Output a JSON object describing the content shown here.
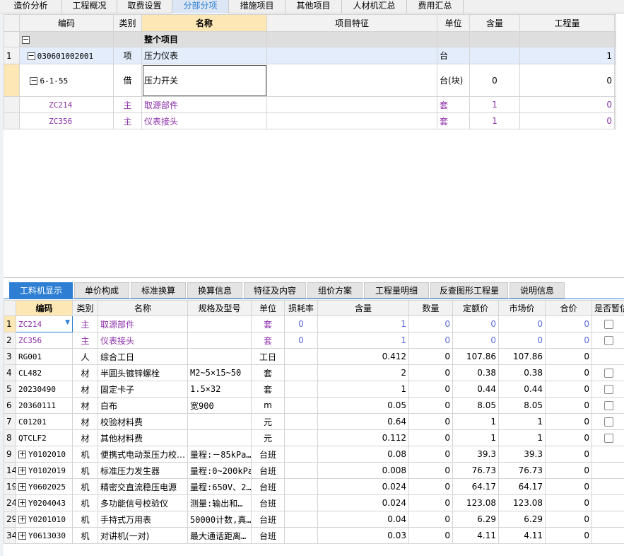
{
  "top_tabs": [
    "造价分析",
    "工程概况",
    "取费设置",
    "分部分项",
    "措施项目",
    "其他项目",
    "人材机汇总",
    "费用汇总"
  ],
  "upper": {
    "headers": [
      "编码",
      "类别",
      "名称",
      "项目特征",
      "单位",
      "含量",
      "工程量"
    ],
    "total_row": {
      "name": "整个项目"
    },
    "item_row": {
      "rownum": "1",
      "code": "030601002001",
      "type": "项",
      "name": "压力仪表",
      "unit": "台",
      "qty": "1",
      "qty2": "1"
    },
    "sub_row": {
      "code": "6-1-55",
      "type": "借",
      "name": "压力开关",
      "unit": "台(块)",
      "content": "0",
      "qty": "0"
    },
    "main_rows": [
      {
        "code": "ZC214",
        "type": "主",
        "name": "取源部件",
        "unit": "套",
        "content": "1",
        "qty": "0"
      },
      {
        "code": "ZC356",
        "type": "主",
        "name": "仪表接头",
        "unit": "套",
        "content": "1",
        "qty": "0"
      }
    ]
  },
  "bottom_tabs": [
    "工料机显示",
    "单价构成",
    "标准换算",
    "换算信息",
    "特征及内容",
    "组价方案",
    "工程量明细",
    "反查图形工程量",
    "说明信息"
  ],
  "lower": {
    "headers": [
      "编码",
      "类别",
      "名称",
      "规格及型号",
      "单位",
      "损耗率",
      "含量",
      "数量",
      "定额价",
      "市场价",
      "合价",
      "是否暂估"
    ],
    "rows": [
      {
        "n": "1",
        "code": "ZC214",
        "type": "主",
        "name": "取源部件",
        "spec": "",
        "unit": "套",
        "loss": "0",
        "content": "1",
        "amount": "0",
        "base": "0",
        "market": "0",
        "total": "0",
        "chk": true,
        "purple": true
      },
      {
        "n": "2",
        "code": "ZC356",
        "type": "主",
        "name": "仪表接头",
        "spec": "",
        "unit": "套",
        "loss": "0",
        "content": "1",
        "amount": "0",
        "base": "0",
        "market": "0",
        "total": "0",
        "chk": true,
        "purple": true
      },
      {
        "n": "3",
        "code": "RG001",
        "type": "人",
        "name": "综合工日",
        "spec": "",
        "unit": "工日",
        "loss": "",
        "content": "0.412",
        "amount": "0",
        "base": "107.86",
        "market": "107.86",
        "total": "0",
        "chk": false
      },
      {
        "n": "4",
        "code": "CL482",
        "type": "材",
        "name": "半圆头镀锌螺栓",
        "spec": "M2~5×15~50",
        "unit": "套",
        "loss": "",
        "content": "2",
        "amount": "0",
        "base": "0.38",
        "market": "0.38",
        "total": "0",
        "chk": true
      },
      {
        "n": "5",
        "code": "20230490",
        "type": "材",
        "name": "固定卡子",
        "spec": "1.5×32",
        "unit": "套",
        "loss": "",
        "content": "1",
        "amount": "0",
        "base": "0.44",
        "market": "0.44",
        "total": "0",
        "chk": true
      },
      {
        "n": "6",
        "code": "20360111",
        "type": "材",
        "name": "白布",
        "spec": "宽900",
        "unit": "m",
        "loss": "",
        "content": "0.05",
        "amount": "0",
        "base": "8.05",
        "market": "8.05",
        "total": "0",
        "chk": true
      },
      {
        "n": "7",
        "code": "C01201",
        "type": "材",
        "name": "校验材料费",
        "spec": "",
        "unit": "元",
        "loss": "",
        "content": "0.64",
        "amount": "0",
        "base": "1",
        "market": "1",
        "total": "0",
        "chk": true
      },
      {
        "n": "8",
        "code": "QTCLF2",
        "type": "材",
        "name": "其他材料费",
        "spec": "",
        "unit": "元",
        "loss": "",
        "content": "0.112",
        "amount": "0",
        "base": "1",
        "market": "1",
        "total": "0",
        "chk": true
      },
      {
        "n": "9",
        "code": "Y0102010",
        "type": "机",
        "name": "便携式电动泵压力校…",
        "spec": "量程:－85kPa…",
        "unit": "台班",
        "loss": "",
        "content": "0.08",
        "amount": "0",
        "base": "39.3",
        "market": "39.3",
        "total": "0",
        "chk": false,
        "expand": true
      },
      {
        "n": "14",
        "code": "Y0102019",
        "type": "机",
        "name": "标准压力发生器",
        "spec": "量程:0~200kPa",
        "unit": "台班",
        "loss": "",
        "content": "0.008",
        "amount": "0",
        "base": "76.73",
        "market": "76.73",
        "total": "0",
        "chk": false,
        "expand": true
      },
      {
        "n": "19",
        "code": "Y0602025",
        "type": "机",
        "name": "精密交直流稳压电源",
        "spec": "量程:650V、2…",
        "unit": "台班",
        "loss": "",
        "content": "0.024",
        "amount": "0",
        "base": "64.17",
        "market": "64.17",
        "total": "0",
        "chk": false,
        "expand": true
      },
      {
        "n": "24",
        "code": "Y0204043",
        "type": "机",
        "name": "多功能信号校验仪",
        "spec": "测量:输出和…",
        "unit": "台班",
        "loss": "",
        "content": "0.024",
        "amount": "0",
        "base": "123.08",
        "market": "123.08",
        "total": "0",
        "chk": false,
        "expand": true
      },
      {
        "n": "29",
        "code": "Y0201010",
        "type": "机",
        "name": "手持式万用表",
        "spec": "50000计数,真…",
        "unit": "台班",
        "loss": "",
        "content": "0.04",
        "amount": "0",
        "base": "6.29",
        "market": "6.29",
        "total": "0",
        "chk": false,
        "expand": true
      },
      {
        "n": "34",
        "code": "Y0613030",
        "type": "机",
        "name": "对讲机(一对)",
        "spec": "最大通话距离…",
        "unit": "台班",
        "loss": "",
        "content": "0.03",
        "amount": "0",
        "base": "4.11",
        "market": "4.11",
        "total": "0",
        "chk": false,
        "expand": true
      }
    ]
  }
}
